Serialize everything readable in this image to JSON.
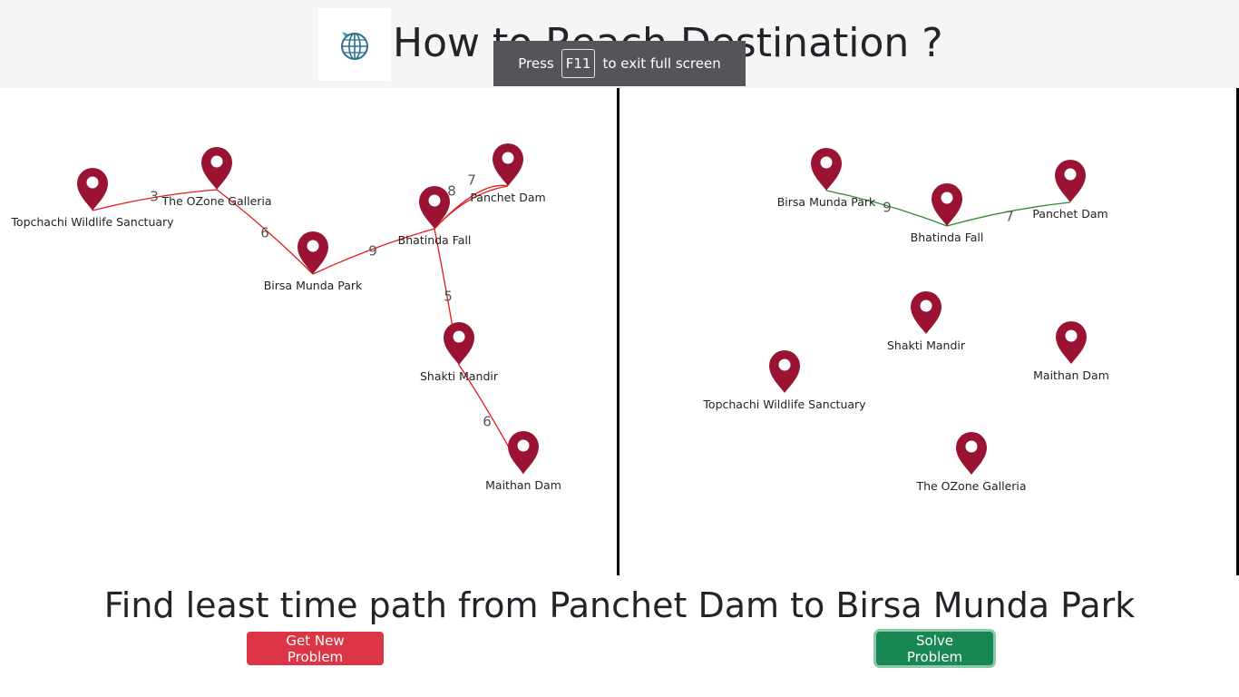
{
  "header": {
    "title": "How to Reach Destination ?",
    "logo_icon": "globe-plane-icon"
  },
  "fullscreen_toast": {
    "prefix": "Press",
    "key": "F11",
    "suffix": "to exit full screen"
  },
  "colors": {
    "marker": "#9b1333",
    "left_edge": "#e31b1b",
    "right_edge": "#2e8b2e",
    "danger": "#dc3545",
    "success": "#198754"
  },
  "left_graph": {
    "nodes": [
      {
        "id": "topchachi",
        "label": "Topchachi Wildlife Sanctuary"
      },
      {
        "id": "ozone",
        "label": "The OZone Galleria"
      },
      {
        "id": "birsa",
        "label": "Birsa Munda Park"
      },
      {
        "id": "bhatinda",
        "label": "Bhatinda Fall"
      },
      {
        "id": "panchet",
        "label": "Panchet Dam"
      },
      {
        "id": "shakti",
        "label": "Shakti Mandir"
      },
      {
        "id": "maithan",
        "label": "Maithan Dam"
      }
    ],
    "edges": [
      {
        "from": "topchachi",
        "to": "ozone",
        "weight": "3"
      },
      {
        "from": "ozone",
        "to": "birsa",
        "weight": "6"
      },
      {
        "from": "birsa",
        "to": "bhatinda",
        "weight": "9"
      },
      {
        "from": "bhatinda",
        "to": "panchet",
        "weight": "8"
      },
      {
        "from": "bhatinda",
        "to": "panchet",
        "weight": "7"
      },
      {
        "from": "bhatinda",
        "to": "shakti",
        "weight": "5"
      },
      {
        "from": "shakti",
        "to": "maithan",
        "weight": "6"
      }
    ]
  },
  "right_graph": {
    "nodes": [
      {
        "id": "birsa",
        "label": "Birsa Munda Park"
      },
      {
        "id": "bhatinda",
        "label": "Bhatinda Fall"
      },
      {
        "id": "panchet",
        "label": "Panchet Dam"
      },
      {
        "id": "shakti",
        "label": "Shakti Mandir"
      },
      {
        "id": "maithan",
        "label": "Maithan Dam"
      },
      {
        "id": "topchachi",
        "label": "Topchachi Wildlife Sanctuary"
      },
      {
        "id": "ozone",
        "label": "The OZone Galleria"
      }
    ],
    "edges": [
      {
        "from": "birsa",
        "to": "bhatinda",
        "weight": "9"
      },
      {
        "from": "bhatinda",
        "to": "panchet",
        "weight": "7"
      }
    ]
  },
  "problem_text": "Find least time path from Panchet Dam to Birsa Munda Park",
  "buttons": {
    "new_problem": "Get New Problem",
    "solve": "Solve Problem"
  }
}
